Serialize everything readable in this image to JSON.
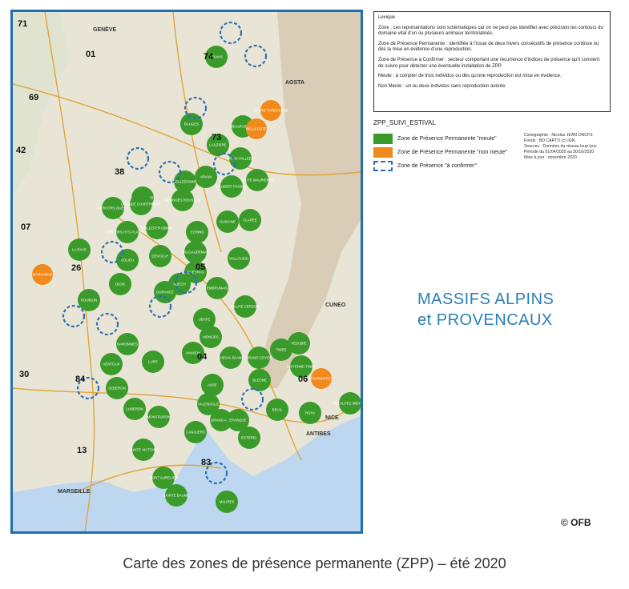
{
  "colors": {
    "meute": "#3a9a2a",
    "non_meute": "#f08a1c",
    "confirm": "#2b6fb4",
    "frame": "#1f6fb4",
    "title": "#2a7fb8"
  },
  "lexique": {
    "heading": "Lexique",
    "zone": "Zone : ces représentations sont schématiques car on ne peut pas identifier avec précision les contours du domaine vital d'un ou plusieurs animaux territorialisés.",
    "zpp": "Zone de Présence Permanente : identifiée à l'issue de deux hivers consécutifs de présence continue ou dès la mise en évidence d'une reproduction.",
    "zpc": "Zone de Présence à Confirmer : secteur comportant une récurrence d'indices de présence qu'il convient de suivre pour détecter une éventuelle installation de ZPP.",
    "meute": "Meute : à compter de trois individus ou dès qu'une reproduction est mise en évidence.",
    "non_meute": "Non Meute : un ou deux individus sans reproduction avérée."
  },
  "legend": {
    "title": "ZPP_SUIVI_ESTIVAL",
    "meute": "Zone de Présence Permanente \"meute\"",
    "non_meute": "Zone de Présence Permanente \"non meute\"",
    "confirm": "Zone de Présence \"à confirmer\""
  },
  "credits": [
    "Cartographie : Nicolas JEAN ONCFS",
    "Fonds : BD CARTO (c) IGN",
    "Sources : Données du réseau loup lynx",
    "Période du 01/04/2020 au 30/10/2020",
    "Mise à jour : novembre 2020"
  ],
  "title_line1": "MASSIFS ALPINS",
  "title_line2": "et PROVENCAUX",
  "copyright": "© OFB",
  "caption": "Carte des zones de présence permanente (ZPP) – été 2020",
  "departments": [
    "71",
    "01",
    "74",
    "69",
    "73",
    "42",
    "38",
    "07",
    "26",
    "05",
    "04",
    "30",
    "84",
    "06",
    "13",
    "83"
  ],
  "place_names": [
    "MARSEILLE",
    "NICE",
    "ANTIBES",
    "CUNEO",
    "AOSTA",
    "GENÈVE"
  ],
  "zones_meute": [
    "ARAVIS",
    "BEAUFORTAIN",
    "LAUZIERE",
    "TROIS_VALLEES",
    "HAUTE_MAURIENNE",
    "ARVAN",
    "GALIBIER_THABOR",
    "BELLEDONNE",
    "VERCORS_HTS_PLATEAUX",
    "VERCORS_OUEST",
    "GRANDES_ROUSSES",
    "TAILLEFER_OBIOU",
    "ECRINS",
    "LA_RAYE",
    "BAUGES",
    "CHARTREUSE",
    "VALGAUDEMAR",
    "VALLOUISE",
    "GUISANE",
    "CLAREE",
    "QUEYRAS",
    "DIOIS",
    "SOLIEU",
    "BUECH",
    "DEVOLUY",
    "EMBRUNAIS",
    "UBAYE",
    "HAUTE_VERDON",
    "MONGES",
    "VANSON",
    "CHEVAL_BLANC",
    "GRAND_COYER",
    "TINEE",
    "VESUBIE",
    "LURE",
    "VENTOUX",
    "LUBERON",
    "MONTFURON",
    "CANJUERS",
    "ESTEREL",
    "MAURES",
    "SAINTE_BAUME",
    "SAINTE_VICTOIRE",
    "MONT_AURELIEN",
    "VALENSOLE",
    "DURANCE",
    "ASSE",
    "BLEONE",
    "ROUBION",
    "BARONNIES",
    "PREALPES_MENTON",
    "MOYENNE_TINEE",
    "BEUIL",
    "ROYA",
    "GRAND_ARC",
    "EPARQUE",
    "SEDERON",
    "GRANDE_CHARTREUSE"
  ],
  "zones_non_meute": [
    "HAUTE_TARENTAISE",
    "BELLECOTE",
    "MARSANNE",
    "TOURNAIRET"
  ]
}
